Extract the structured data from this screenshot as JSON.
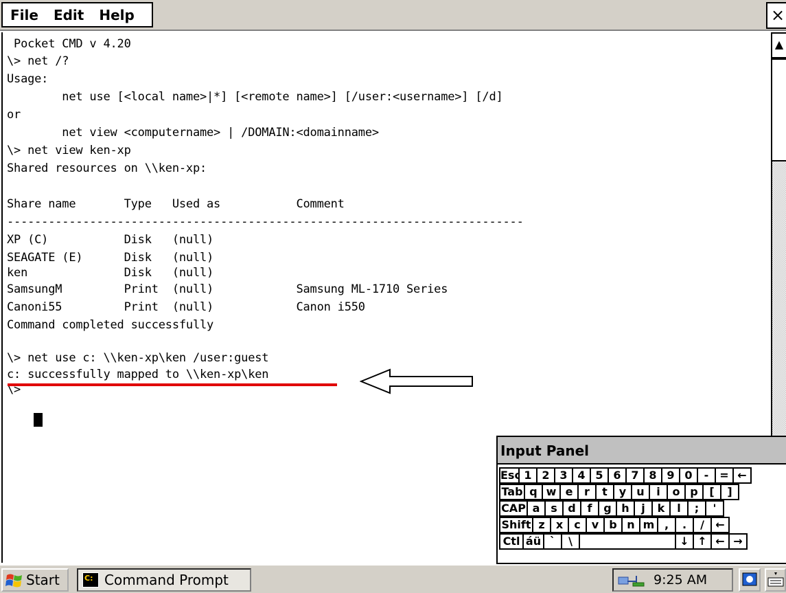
{
  "menu": {
    "file": "File",
    "edit": "Edit",
    "help": "Help",
    "close": "×"
  },
  "console": {
    "lines": [
      " Pocket CMD v 4.20",
      "\\> net /?",
      "Usage:",
      "        net use [<local name>|*] [<remote name>] [/user:<username>] [/d]",
      "or",
      "        net view <computername> | /DOMAIN:<domainname>",
      "\\> net view ken-xp",
      "Shared resources on \\\\ken-xp:",
      "",
      "Share name       Type   Used as           Comment",
      "---------------------------------------------------------------------------",
      "XP (C)           Disk   (null)",
      "SEAGATE (E)      Disk   (null)",
      "ken              Disk   (null)",
      "SamsungM         Print  (null)            Samsung ML-1710 Series",
      "Canoni55         Print  (null)            Canon i550",
      "Command completed successfully",
      "",
      "\\> net use c: \\\\ken-xp\\ken /user:guest",
      "c: successfully mapped to \\\\ken-xp\\ken",
      "\\> "
    ]
  },
  "input_panel": {
    "title": "Input Panel",
    "rows": [
      [
        "Esc",
        "1",
        "2",
        "3",
        "4",
        "5",
        "6",
        "7",
        "8",
        "9",
        "0",
        "-",
        "=",
        "←"
      ],
      [
        "Tab",
        "q",
        "w",
        "e",
        "r",
        "t",
        "y",
        "u",
        "i",
        "o",
        "p",
        "[",
        "]"
      ],
      [
        "CAP",
        "a",
        "s",
        "d",
        "f",
        "g",
        "h",
        "j",
        "k",
        "l",
        ";",
        "'"
      ],
      [
        "Shift",
        "z",
        "x",
        "c",
        "v",
        "b",
        "n",
        "m",
        ",",
        ".",
        "/",
        "←"
      ],
      [
        "Ctl",
        "áü",
        "`",
        "\\",
        " ",
        "↓",
        "↑",
        "←",
        "→"
      ]
    ]
  },
  "taskbar": {
    "start": "Start",
    "task": "Command Prompt",
    "clock": "9:25 AM"
  },
  "colors": {
    "chrome": "#d4d0c8",
    "highlight": "#e00000"
  }
}
